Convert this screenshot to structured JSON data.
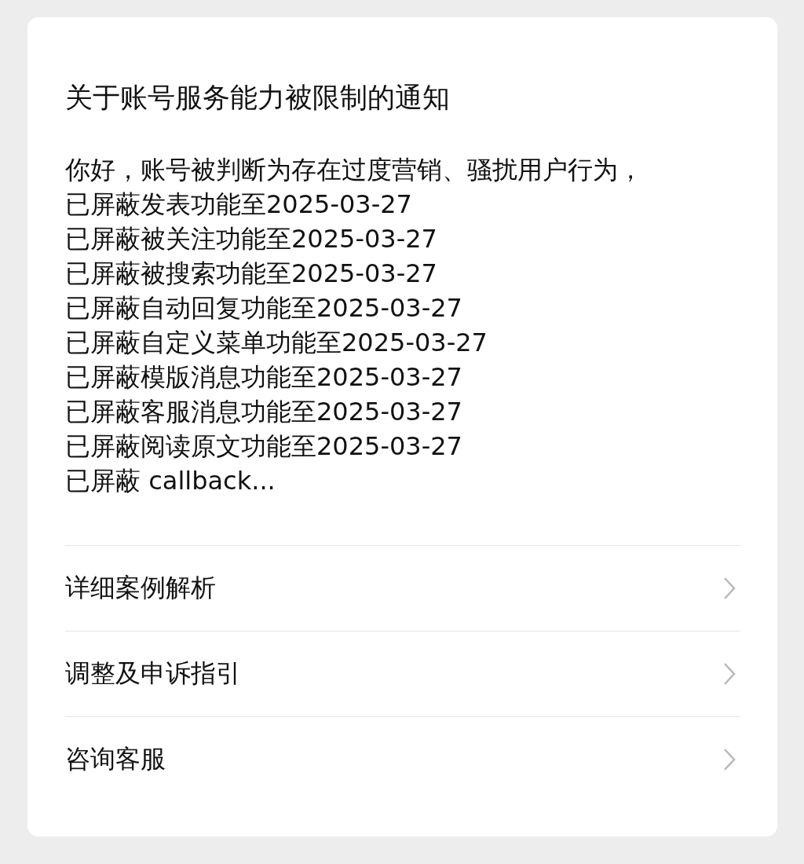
{
  "notice": {
    "title": "关于账号服务能力被限制的通知",
    "lines": [
      "你好，账号被判断为存在过度营销、骚扰用户行为，",
      "已屏蔽发表功能至2025-03-27",
      "已屏蔽被关注功能至2025-03-27",
      "已屏蔽被搜索功能至2025-03-27",
      "已屏蔽自动回复功能至2025-03-27",
      "已屏蔽自定义菜单功能至2025-03-27",
      "已屏蔽模版消息功能至2025-03-27",
      "已屏蔽客服消息功能至2025-03-27",
      "已屏蔽阅读原文功能至2025-03-27",
      "已屏蔽 callback..."
    ]
  },
  "menu": [
    {
      "label": "详细案例解析"
    },
    {
      "label": "调整及申诉指引"
    },
    {
      "label": "咨询客服"
    }
  ]
}
